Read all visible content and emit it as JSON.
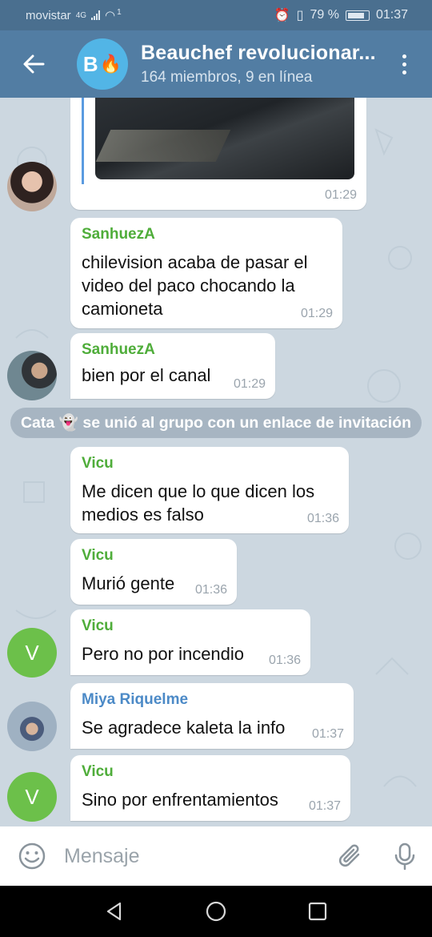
{
  "status_bar": {
    "carrier": "movistar",
    "network": "4G",
    "wifi_level": "1",
    "battery": "79 %",
    "time": "01:37"
  },
  "header": {
    "group_initial": "B",
    "group_emoji": "🔥",
    "title": "Beauchef revolucionar...",
    "subtitle": "164 miembros, 9 en línea"
  },
  "messages": {
    "m0": {
      "time": "01:29"
    },
    "m1": {
      "sender": "SanhuezA",
      "text": "chilevision acaba de pasar el video del paco chocando la camioneta",
      "time": "01:29"
    },
    "m2": {
      "sender": "SanhuezA",
      "text": "bien por el canal",
      "time": "01:29"
    },
    "service": "Cata 👻 se unió al grupo con un enlace de invitación",
    "m3": {
      "sender": "Vicu",
      "text": "Me dicen que lo que dicen los medios es falso",
      "time": "01:36"
    },
    "m4": {
      "sender": "Vicu",
      "text": "Murió gente",
      "time": "01:36"
    },
    "m5": {
      "sender": "Vicu",
      "avatar_letter": "V",
      "text": "Pero no por incendio",
      "time": "01:36"
    },
    "m6": {
      "sender": "Miya Riquelme",
      "text": "Se agradece kaleta la info",
      "time": "01:37"
    },
    "m7": {
      "sender": "Vicu",
      "avatar_letter": "V",
      "text": "Sino por enfrentamientos",
      "time": "01:37"
    }
  },
  "input": {
    "placeholder": "Mensaje"
  },
  "colors": {
    "header": "#527da3",
    "status_bar": "#4a6f8f",
    "chat_background": "#ccd7e0",
    "sender_green": "#4fad3a",
    "sender_blue": "#4c8ac7"
  },
  "icons": [
    "back-arrow-icon",
    "more-vert-icon",
    "emoji-icon",
    "attach-icon",
    "mic-icon",
    "nav-back-icon",
    "nav-home-icon",
    "nav-recents-icon"
  ]
}
